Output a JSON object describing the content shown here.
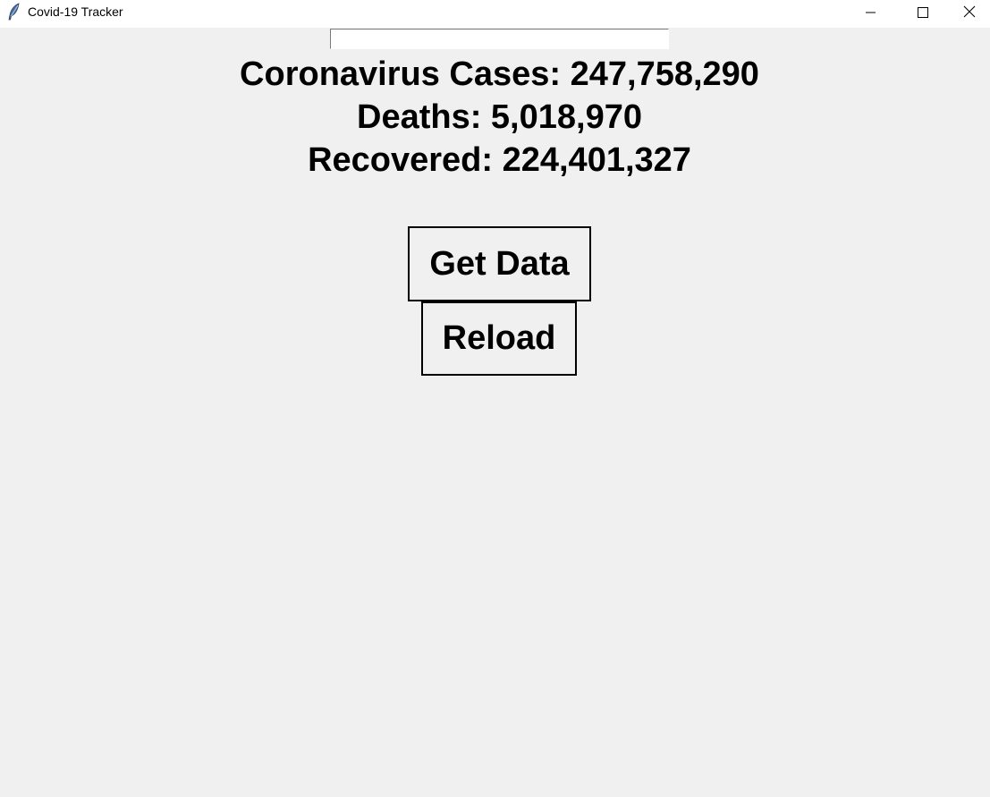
{
  "window": {
    "title": "Covid-19 Tracker",
    "icon": "feather-icon",
    "controls": [
      "minimize-icon",
      "maximize-icon",
      "close-icon"
    ]
  },
  "search": {
    "value": "",
    "placeholder": ""
  },
  "stats": {
    "cases": "Coronavirus Cases: 247,758,290",
    "deaths": "Deaths: 5,018,970",
    "recovered": "Recovered: 224,401,327"
  },
  "buttons": {
    "get_data": "Get Data",
    "reload": "Reload"
  },
  "colors": {
    "background": "#f0f0f0",
    "titlebar": "#ffffff",
    "text": "#000000",
    "entry_background": "#ffffff"
  }
}
